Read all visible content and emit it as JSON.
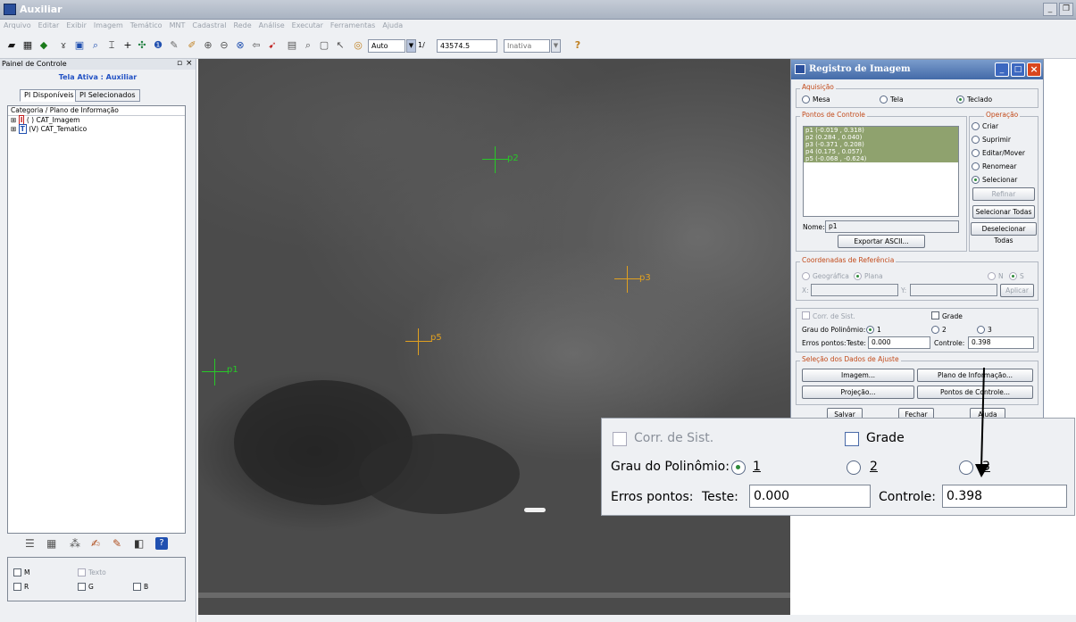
{
  "window": {
    "title": "Auxiliar"
  },
  "menu": [
    "Arquivo",
    "Editar",
    "Exibir",
    "Imagem",
    "Temático",
    "MNT",
    "Cadastral",
    "Rede",
    "Análise",
    "Executar",
    "Ferramentas",
    "Ajuda"
  ],
  "toolbar": {
    "zoom_mode": "Auto",
    "scale_prefix": "1/",
    "scale_value": "43574.5",
    "state_value": "Inativa"
  },
  "left_panel": {
    "title": "Painel de Controle",
    "active_screen": "Tela Ativa : Auxiliar",
    "tabs": [
      "PI Disponíveis",
      "PI Selecionados"
    ],
    "list_header": "Categoria / Plano de Informação",
    "categories": [
      {
        "badge": "I",
        "badge_color": "#c42020",
        "label": "( ) CAT_Imagem"
      },
      {
        "badge": "T",
        "badge_color": "#2050b0",
        "label": "(V) CAT_Tematico"
      }
    ],
    "channels": [
      {
        "label": "M"
      },
      {
        "label": "Texto",
        "disabled": true
      },
      {
        "label": "R"
      },
      {
        "label": "G"
      },
      {
        "label": "B"
      }
    ]
  },
  "map": {
    "points": [
      {
        "label": "p2",
        "color": "#28c828"
      },
      {
        "label": "p3",
        "color": "#e0a020"
      },
      {
        "label": "p5",
        "color": "#e0a020"
      },
      {
        "label": "p1",
        "color": "#28c828"
      }
    ]
  },
  "dialog": {
    "title": "Registro de Imagem",
    "acquisition": {
      "label": "Aquisição",
      "options": [
        "Mesa",
        "Tela",
        "Teclado"
      ],
      "selected": "Teclado"
    },
    "control_points": {
      "label": "Pontos de Controle",
      "items": [
        "p1 (-0.019 , 0.318)",
        "p2 (0.284 , 0.040)",
        "p3 (-0.371 , 0.208)",
        "p4 (0.175 , 0.057)",
        "p5 (-0.068 , -0.624)"
      ],
      "name_label": "Nome:",
      "name_value": "p1",
      "export_button": "Exportar ASCII..."
    },
    "operation": {
      "label": "Operação",
      "options": [
        "Criar",
        "Suprimir",
        "Editar/Mover",
        "Renomear",
        "Selecionar"
      ],
      "selected": "Selecionar",
      "refine_button": "Refinar",
      "select_all_button": "Selecionar Todas",
      "deselect_all_button": "Deselecionar Todas"
    },
    "reference": {
      "label": "Coordenadas de Referência",
      "geo": "Geográfica",
      "plana": "Plana",
      "n": "N",
      "s": "S",
      "x_label": "X:",
      "y_label": "Y:",
      "apply_button": "Aplicar"
    },
    "correction": {
      "corr_label": "Corr. de Sist.",
      "grid_label": "Grade",
      "poly_label": "Grau do Polinômio:",
      "poly_options": [
        "1",
        "2",
        "3"
      ],
      "poly_selected": "1",
      "errors_label": "Erros pontos:",
      "test_label": "Teste:",
      "test_value": "0.000",
      "control_label": "Controle:",
      "control_value": "0.398"
    },
    "adjust": {
      "label": "Seleção dos Dados de Ajuste",
      "image_button": "Imagem...",
      "info_plan_button": "Plano de Informação...",
      "projection_button": "Projeção...",
      "control_points_button": "Pontos de Controle..."
    },
    "footer": {
      "save": "Salvar",
      "close": "Fechar",
      "help": "Ajuda"
    }
  }
}
